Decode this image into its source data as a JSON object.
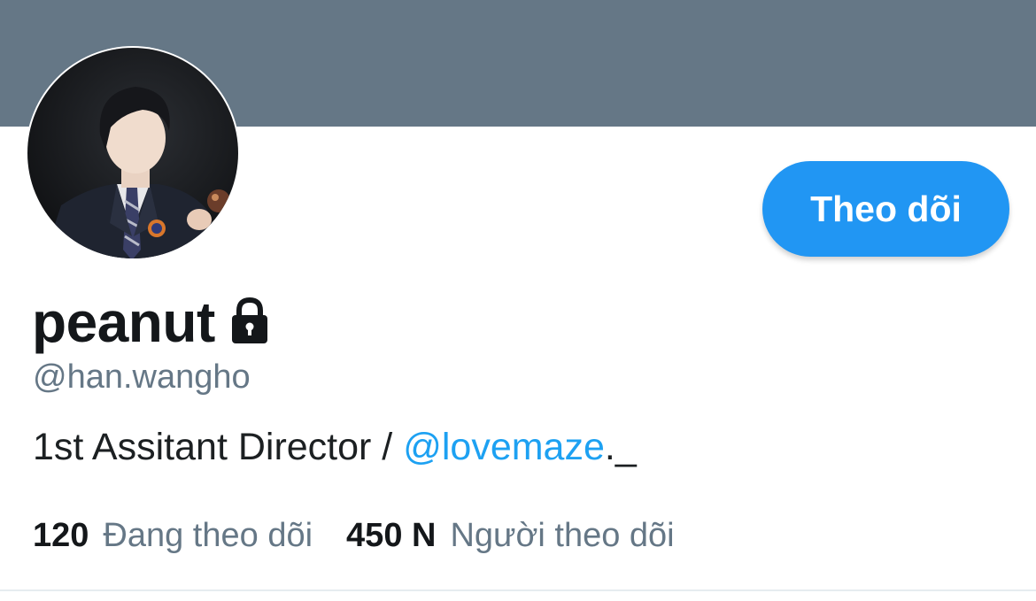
{
  "profile": {
    "display_name": "peanut",
    "handle": "@han.wangho",
    "bio": {
      "prefix": "1st Assitant Director / ",
      "mention": "@lovemaze",
      "suffix": "._"
    },
    "protected_icon": "lock-icon",
    "avatar_icon": "profile-photo"
  },
  "actions": {
    "follow_label": "Theo dõi"
  },
  "stats": {
    "following_count": "120",
    "following_label": "Đang theo dõi",
    "followers_count": "450 N",
    "followers_label": "Người theo dõi"
  },
  "colors": {
    "banner": "#657786",
    "accent": "#1da1f2",
    "button": "#2196f3",
    "text_primary": "#14171a",
    "text_secondary": "#657786",
    "text_body": "#1c2022",
    "divider": "#e6ecf0"
  }
}
